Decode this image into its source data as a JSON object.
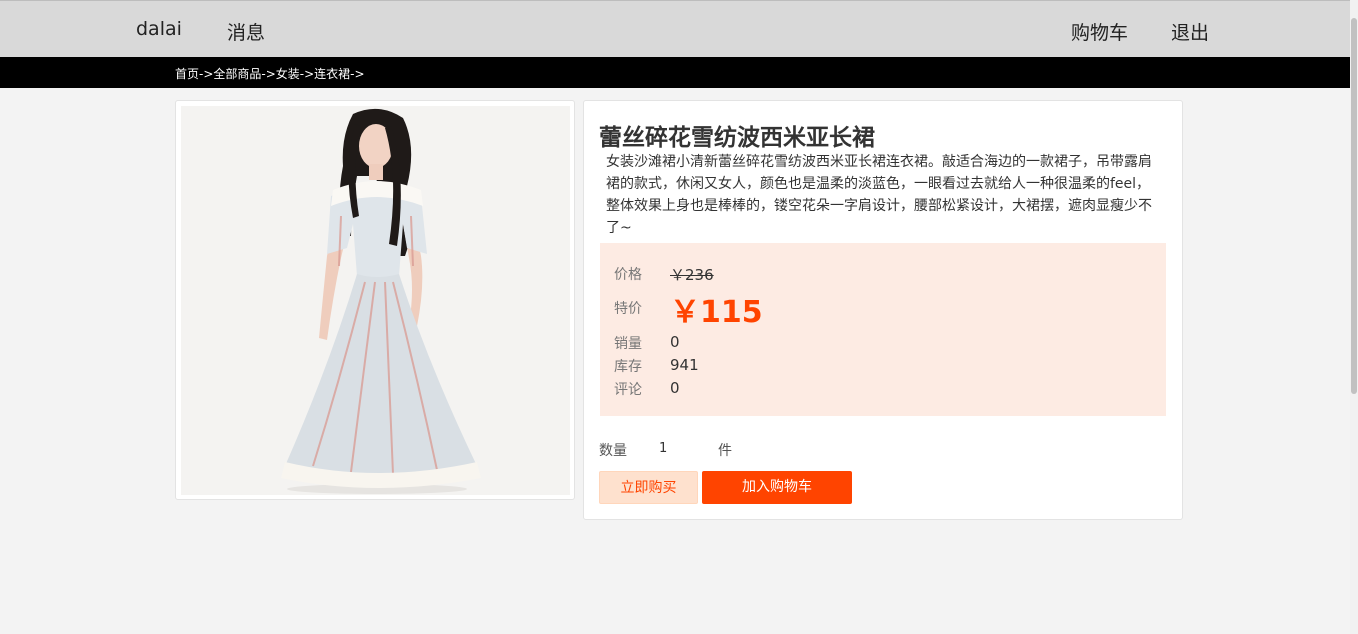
{
  "header": {
    "username": "dalai",
    "messages_label": "消息",
    "cart_label": "购物车",
    "logout_label": "退出"
  },
  "breadcrumb": "首页->全部商品->女装->连衣裙->",
  "product": {
    "title": "蕾丝碎花雪纺波西米亚长裙",
    "description": "女装沙滩裙小清新蕾丝碎花雪纺波西米亚长裙连衣裙。敲适合海边的一款裙子，吊带露肩裙的款式，休闲又女人，颜色也是温柔的淡蓝色，一眼看过去就给人一种很温柔的feel，整体效果上身也是棒棒的，镂空花朵一字肩设计，腰部松紧设计，大裙摆，遮肉显瘦少不了~",
    "price_label": "价格",
    "original_price": "￥236",
    "sale_label": "特价",
    "sale_price": "￥115",
    "sales_label": "销量",
    "sales_value": "0",
    "stock_label": "库存",
    "stock_value": "941",
    "reviews_label": "评论",
    "reviews_value": "0"
  },
  "purchase": {
    "quantity_label": "数量",
    "quantity_value": "1",
    "quantity_unit": "件",
    "buy_now_label": "立即购买",
    "add_to_cart_label": "加入购物车"
  },
  "colors": {
    "accent": "#ff4400",
    "price_bg": "#fdebe3",
    "header_bg": "#d9d9d9",
    "breadcrumb_bg": "#000000"
  }
}
